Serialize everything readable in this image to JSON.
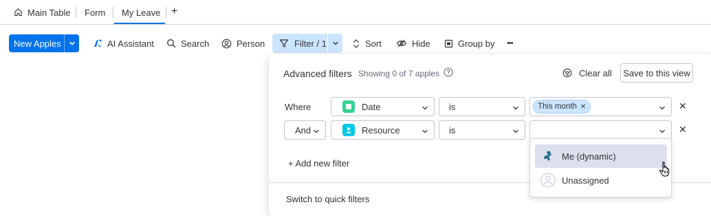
{
  "tabs": {
    "main_table": "Main Table",
    "form": "Form",
    "my_leave": "My Leave",
    "add": "+"
  },
  "toolbar": {
    "new_button": "New Apples",
    "ai_assistant": "AI Assistant",
    "search": "Search",
    "person": "Person",
    "filter": "Filter / 1",
    "sort": "Sort",
    "hide": "Hide",
    "group_by": "Group by",
    "more": "•••"
  },
  "panel": {
    "title": "Advanced filters",
    "subtitle": "Showing 0 of 7 apples",
    "clear_all": "Clear all",
    "save_view": "Save to this view",
    "add_filter": "+ Add new filter",
    "switch_quick": "Switch to quick filters",
    "rows": [
      {
        "label": "Where",
        "column": "Date",
        "operator": "is",
        "value_chip": "This month",
        "column_icon_color": "#33d391"
      },
      {
        "label": "And",
        "column": "Resource",
        "operator": "is",
        "value_chip": "",
        "column_icon_color": "#00c8e8"
      }
    ]
  },
  "dropdown": {
    "options": [
      {
        "label": "Me (dynamic)",
        "icon": "person-dynamic-icon"
      },
      {
        "label": "Unassigned",
        "icon": "unassigned-avatar-icon"
      }
    ]
  },
  "colors": {
    "accent": "#0073ea",
    "selected_bg": "#cce5ff",
    "hover_bg": "#dcdfec"
  }
}
